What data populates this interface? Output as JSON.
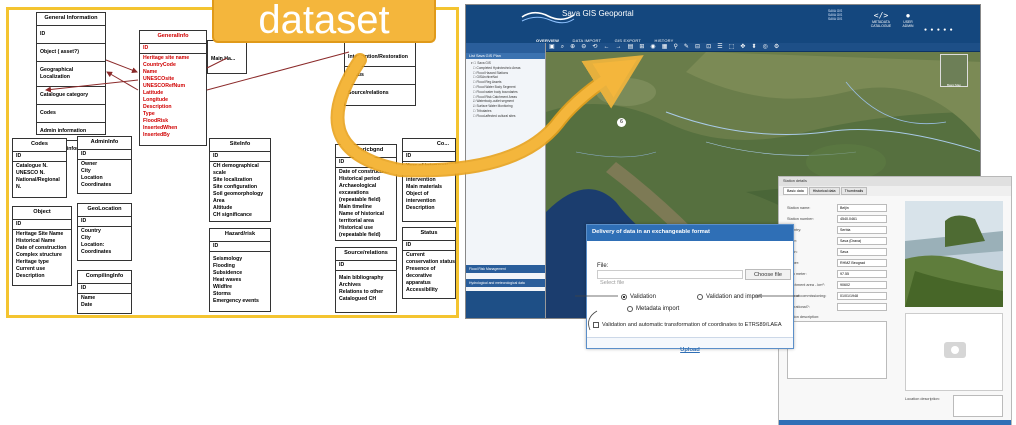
{
  "callout": {
    "text": "dataset"
  },
  "schema": {
    "general": {
      "title": "General Information",
      "rows": [
        "ID",
        "Object ( asset?)",
        "Geographical Localization",
        "Catalogue category",
        "Codes",
        "Admin information",
        "Compiling information"
      ]
    },
    "genealinfo": {
      "title": "GeneralInfo",
      "id": "ID",
      "fields": [
        "Heritage site name",
        "CountryCode",
        "Name",
        "UNESCOsite",
        "UNESCORefNum",
        "Latitude",
        "Longitude",
        "Description",
        "Type",
        "FloodRisk",
        "InsertedWhen",
        "InsertedBy"
      ]
    },
    "partial_left": {
      "title": "",
      "rows": [
        "Main Ha..."
      ]
    },
    "restoration": {
      "title": "",
      "rows": [
        "Intervention/Restoration",
        "Status",
        "Source/relations"
      ]
    },
    "codes": {
      "title": "Codes",
      "id": "ID",
      "fields": [
        "Catalogue N.",
        "UNESCO N.",
        "National/Regional",
        "N."
      ]
    },
    "admininfo": {
      "title": "AdminInfo",
      "id": "ID",
      "fields": [
        "Owner",
        "City",
        "Location",
        "Coordinates"
      ]
    },
    "object": {
      "title": "Object",
      "id": "ID",
      "fields": [
        "Heritage Site Name",
        "Historical Name",
        "Date of construction",
        "Complex structure",
        "Heritage type",
        "Current use",
        "Description"
      ]
    },
    "geolocation": {
      "title": "GeoLocation",
      "id": "ID",
      "fields": [
        "Country",
        "City",
        "Location:",
        "Coordinates"
      ]
    },
    "compilinginfo": {
      "title": "CompilingInfo",
      "id": "ID",
      "fields": [
        "Name",
        "Date"
      ]
    },
    "siteinfo": {
      "title": "SiteInfo",
      "id": "ID",
      "fields": [
        "CH demographical",
        "scale",
        "Site localization",
        "Site configuration",
        "Soil geomorphology",
        "Area",
        "Altitude",
        "CH significance"
      ]
    },
    "hazard": {
      "title": "Hazard/risk",
      "id": "ID",
      "fields": [
        "Seismology",
        "Flooding",
        "Subsidence",
        "Heat waves",
        "Wildfire",
        "Storms",
        "Emergency events"
      ]
    },
    "historicbgnd": {
      "title": "Historicbgnd",
      "id": "ID",
      "fields": [
        "Date of construction",
        "Historical period",
        "Archaeological",
        "excavations",
        "(repeatable field)",
        "Main timeline",
        "Name of historical",
        "territorial area",
        "Historical use",
        "(repeatable field)"
      ]
    },
    "sources": {
      "title": "Source/relations",
      "id": "ID",
      "fields": [
        "Main bibliography",
        "Archives",
        "Relations to other",
        "Catalogued CH"
      ]
    },
    "conservation": {
      "title": "Co...",
      "id": "ID",
      "fields": [
        "Year of intervention",
        "Typology of",
        "intervention",
        "Main materials",
        "Object of",
        "intervention",
        "Description"
      ]
    },
    "status": {
      "title": "Status",
      "id": "ID",
      "fields": [
        "Current",
        "conservation status",
        "Presence of",
        "decorative",
        "apparatus",
        "Accessibility"
      ]
    }
  },
  "gis": {
    "title": "Sava GIS Geoportal",
    "nav": [
      "OVERVIEW",
      "DATA IMPORT",
      "GIS EXPORT",
      "HISTORY"
    ],
    "user_lines": [
      "SAVA GIS",
      "SAVA GIS",
      "SAVA GIS"
    ],
    "right_labels": [
      "METADATA CATALOGUE",
      "USER ADMIN"
    ],
    "side_title": "List Sava GIS Plan",
    "side_items": [
      "Sava GIS",
      "Completed Hydrotechnic Areas",
      "Flood Hazard Stations",
      "GISArchiveNat",
      "Flood Reg Assets",
      "Flood Water Body Segment",
      "Flood water body boundaries",
      "Flood Risk Catchment Areas",
      "Waterbody-outlet segment",
      "Surface Water Monitoring",
      "Tributaries",
      "Flood-affected cultural sites"
    ],
    "side_sections": [
      "Flood Risk Management",
      "Hydrological and meteorological data"
    ],
    "map_marker": "6",
    "legend": "Basic Map"
  },
  "station": {
    "tabs": [
      "Station details",
      "Basic data",
      "Historical data",
      "Thumbnails"
    ],
    "fields": [
      {
        "label": "Station name:",
        "value": "Beljin"
      },
      {
        "label": "Station number:",
        "value": "4540.0461"
      },
      {
        "label": "Country:",
        "value": "Serbia"
      },
      {
        "label": "River:",
        "value": "Sava (Drava)"
      },
      {
        "label": "Basin:",
        "value": "Sava"
      },
      {
        "label": "Owner:",
        "value": "RHMZ Beograd"
      },
      {
        "label": "Zero meter:",
        "value": "97.55"
      },
      {
        "label": "Catchment area - km²:",
        "value": "90602"
      },
      {
        "label": "Date of commissioning:",
        "value": "01/01/1948"
      },
      {
        "label": "Operational?:",
        "value": ""
      }
    ],
    "location_label": "Location description:",
    "description_label": "Station description:",
    "footer": "Close"
  },
  "dialog": {
    "title": "Delivery of data in an exchangeable format",
    "file_label": "File:",
    "file_placeholder": "Select file",
    "choose_label": "Choose file",
    "radio_validation": "Validation",
    "radio_validation_import": "Validation and import",
    "radio_metadata": "Metadata import",
    "checkbox_label": "Validation and automatic transformation of coordinates to ETRS89/LAEA",
    "upload_label": "Upload"
  },
  "colors": {
    "accent": "#f4b63c",
    "frame": "#f4c430",
    "portal_blue": "#14477e",
    "dialog_blue": "#2f6fb6",
    "relation_red": "#8b2a2a"
  }
}
